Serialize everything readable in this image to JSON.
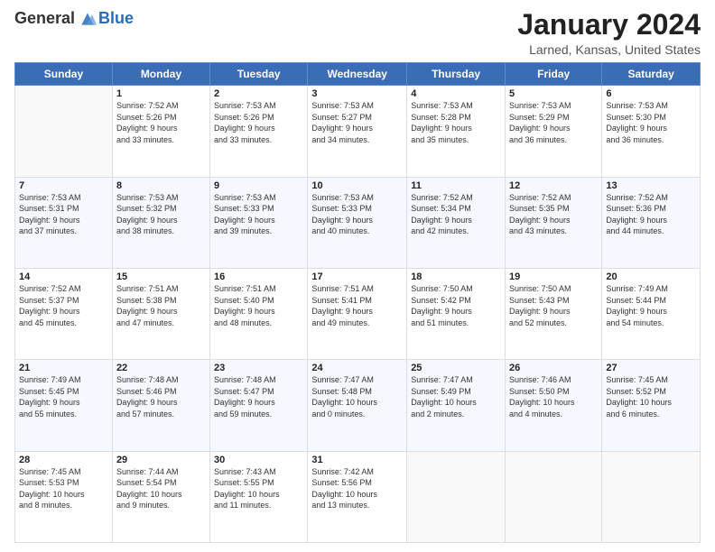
{
  "header": {
    "logo_general": "General",
    "logo_blue": "Blue",
    "month_title": "January 2024",
    "location": "Larned, Kansas, United States"
  },
  "weekdays": [
    "Sunday",
    "Monday",
    "Tuesday",
    "Wednesday",
    "Thursday",
    "Friday",
    "Saturday"
  ],
  "weeks": [
    [
      {
        "day": "",
        "info": ""
      },
      {
        "day": "1",
        "info": "Sunrise: 7:52 AM\nSunset: 5:26 PM\nDaylight: 9 hours\nand 33 minutes."
      },
      {
        "day": "2",
        "info": "Sunrise: 7:53 AM\nSunset: 5:26 PM\nDaylight: 9 hours\nand 33 minutes."
      },
      {
        "day": "3",
        "info": "Sunrise: 7:53 AM\nSunset: 5:27 PM\nDaylight: 9 hours\nand 34 minutes."
      },
      {
        "day": "4",
        "info": "Sunrise: 7:53 AM\nSunset: 5:28 PM\nDaylight: 9 hours\nand 35 minutes."
      },
      {
        "day": "5",
        "info": "Sunrise: 7:53 AM\nSunset: 5:29 PM\nDaylight: 9 hours\nand 36 minutes."
      },
      {
        "day": "6",
        "info": "Sunrise: 7:53 AM\nSunset: 5:30 PM\nDaylight: 9 hours\nand 36 minutes."
      }
    ],
    [
      {
        "day": "7",
        "info": "Sunrise: 7:53 AM\nSunset: 5:31 PM\nDaylight: 9 hours\nand 37 minutes."
      },
      {
        "day": "8",
        "info": "Sunrise: 7:53 AM\nSunset: 5:32 PM\nDaylight: 9 hours\nand 38 minutes."
      },
      {
        "day": "9",
        "info": "Sunrise: 7:53 AM\nSunset: 5:33 PM\nDaylight: 9 hours\nand 39 minutes."
      },
      {
        "day": "10",
        "info": "Sunrise: 7:53 AM\nSunset: 5:33 PM\nDaylight: 9 hours\nand 40 minutes."
      },
      {
        "day": "11",
        "info": "Sunrise: 7:52 AM\nSunset: 5:34 PM\nDaylight: 9 hours\nand 42 minutes."
      },
      {
        "day": "12",
        "info": "Sunrise: 7:52 AM\nSunset: 5:35 PM\nDaylight: 9 hours\nand 43 minutes."
      },
      {
        "day": "13",
        "info": "Sunrise: 7:52 AM\nSunset: 5:36 PM\nDaylight: 9 hours\nand 44 minutes."
      }
    ],
    [
      {
        "day": "14",
        "info": "Sunrise: 7:52 AM\nSunset: 5:37 PM\nDaylight: 9 hours\nand 45 minutes."
      },
      {
        "day": "15",
        "info": "Sunrise: 7:51 AM\nSunset: 5:38 PM\nDaylight: 9 hours\nand 47 minutes."
      },
      {
        "day": "16",
        "info": "Sunrise: 7:51 AM\nSunset: 5:40 PM\nDaylight: 9 hours\nand 48 minutes."
      },
      {
        "day": "17",
        "info": "Sunrise: 7:51 AM\nSunset: 5:41 PM\nDaylight: 9 hours\nand 49 minutes."
      },
      {
        "day": "18",
        "info": "Sunrise: 7:50 AM\nSunset: 5:42 PM\nDaylight: 9 hours\nand 51 minutes."
      },
      {
        "day": "19",
        "info": "Sunrise: 7:50 AM\nSunset: 5:43 PM\nDaylight: 9 hours\nand 52 minutes."
      },
      {
        "day": "20",
        "info": "Sunrise: 7:49 AM\nSunset: 5:44 PM\nDaylight: 9 hours\nand 54 minutes."
      }
    ],
    [
      {
        "day": "21",
        "info": "Sunrise: 7:49 AM\nSunset: 5:45 PM\nDaylight: 9 hours\nand 55 minutes."
      },
      {
        "day": "22",
        "info": "Sunrise: 7:48 AM\nSunset: 5:46 PM\nDaylight: 9 hours\nand 57 minutes."
      },
      {
        "day": "23",
        "info": "Sunrise: 7:48 AM\nSunset: 5:47 PM\nDaylight: 9 hours\nand 59 minutes."
      },
      {
        "day": "24",
        "info": "Sunrise: 7:47 AM\nSunset: 5:48 PM\nDaylight: 10 hours\nand 0 minutes."
      },
      {
        "day": "25",
        "info": "Sunrise: 7:47 AM\nSunset: 5:49 PM\nDaylight: 10 hours\nand 2 minutes."
      },
      {
        "day": "26",
        "info": "Sunrise: 7:46 AM\nSunset: 5:50 PM\nDaylight: 10 hours\nand 4 minutes."
      },
      {
        "day": "27",
        "info": "Sunrise: 7:45 AM\nSunset: 5:52 PM\nDaylight: 10 hours\nand 6 minutes."
      }
    ],
    [
      {
        "day": "28",
        "info": "Sunrise: 7:45 AM\nSunset: 5:53 PM\nDaylight: 10 hours\nand 8 minutes."
      },
      {
        "day": "29",
        "info": "Sunrise: 7:44 AM\nSunset: 5:54 PM\nDaylight: 10 hours\nand 9 minutes."
      },
      {
        "day": "30",
        "info": "Sunrise: 7:43 AM\nSunset: 5:55 PM\nDaylight: 10 hours\nand 11 minutes."
      },
      {
        "day": "31",
        "info": "Sunrise: 7:42 AM\nSunset: 5:56 PM\nDaylight: 10 hours\nand 13 minutes."
      },
      {
        "day": "",
        "info": ""
      },
      {
        "day": "",
        "info": ""
      },
      {
        "day": "",
        "info": ""
      }
    ]
  ]
}
